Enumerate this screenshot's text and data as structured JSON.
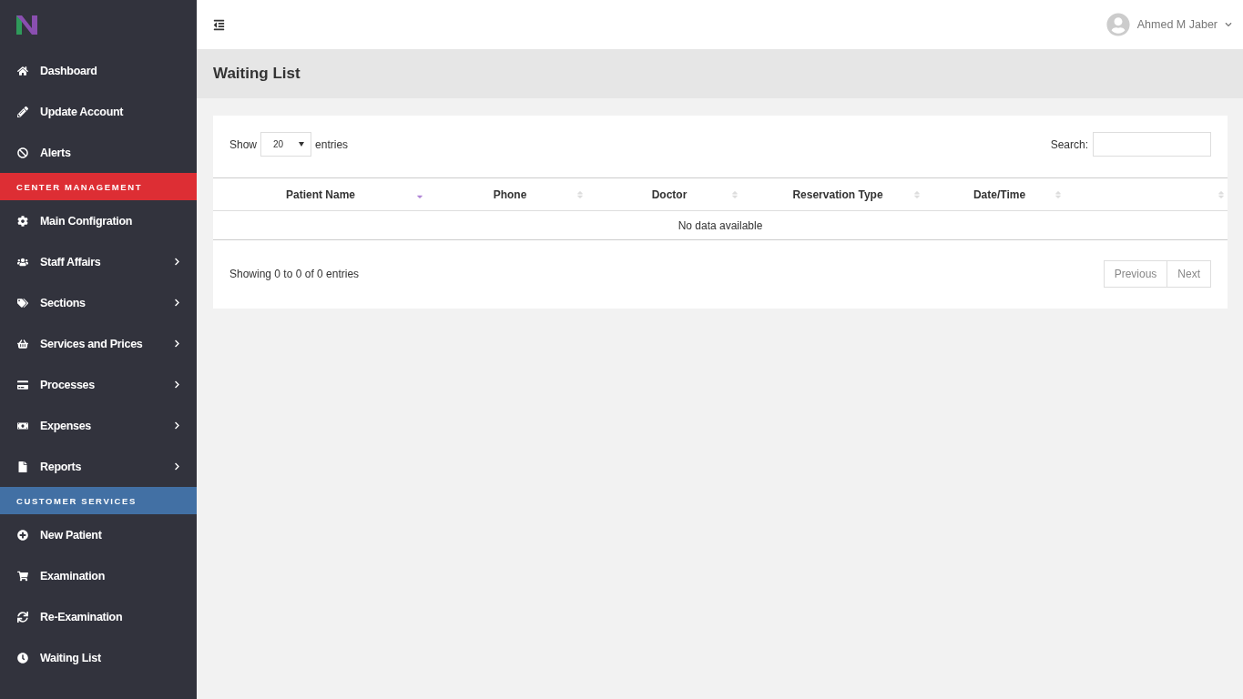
{
  "sidebar": {
    "items": [
      {
        "kind": "item",
        "label": "Dashboard",
        "submenu": false,
        "selected": false
      },
      {
        "kind": "item",
        "label": "Update Account",
        "submenu": false,
        "selected": false
      },
      {
        "kind": "item",
        "label": "Alerts",
        "submenu": false,
        "selected": false
      },
      {
        "kind": "header",
        "label": "CENTER MANAGEMENT",
        "color": "#dd2e34"
      },
      {
        "kind": "item",
        "label": "Main Configration",
        "submenu": false,
        "selected": false
      },
      {
        "kind": "item",
        "label": "Staff Affairs",
        "submenu": true,
        "selected": false
      },
      {
        "kind": "item",
        "label": "Sections",
        "submenu": true,
        "selected": false
      },
      {
        "kind": "item",
        "label": "Services and Prices",
        "submenu": true,
        "selected": false
      },
      {
        "kind": "item",
        "label": "Processes",
        "submenu": true,
        "selected": false
      },
      {
        "kind": "item",
        "label": "Expenses",
        "submenu": true,
        "selected": false
      },
      {
        "kind": "item",
        "label": "Reports",
        "submenu": true,
        "selected": false
      },
      {
        "kind": "header",
        "label": "CUSTOMER SERVICES",
        "color": "#4270a4"
      },
      {
        "kind": "item",
        "label": "New Patient",
        "submenu": false,
        "selected": false
      },
      {
        "kind": "item",
        "label": "Examination",
        "submenu": false,
        "selected": false
      },
      {
        "kind": "item",
        "label": "Re-Examination",
        "submenu": false,
        "selected": false
      },
      {
        "kind": "item",
        "label": "Waiting List",
        "submenu": false,
        "selected": false
      }
    ]
  },
  "user": {
    "name": "Ahmed M Jaber"
  },
  "page_title": "Waiting List",
  "table_controls": {
    "show_label": "Show",
    "page_size": "20",
    "entries_label": "entries",
    "search_label": "Search:"
  },
  "table": {
    "columns": [
      {
        "label": "Patient Name",
        "sorted": true
      },
      {
        "label": "Phone",
        "sorted": false
      },
      {
        "label": "Doctor",
        "sorted": false
      },
      {
        "label": "Reservation Type",
        "sorted": false
      },
      {
        "label": "Date/Time",
        "sorted": false
      },
      {
        "sorted": false
      }
    ],
    "empty_message": "No data available"
  },
  "info": "Showing 0 to 0 of 0 entries",
  "pagination": [
    "Previous",
    "Next"
  ]
}
